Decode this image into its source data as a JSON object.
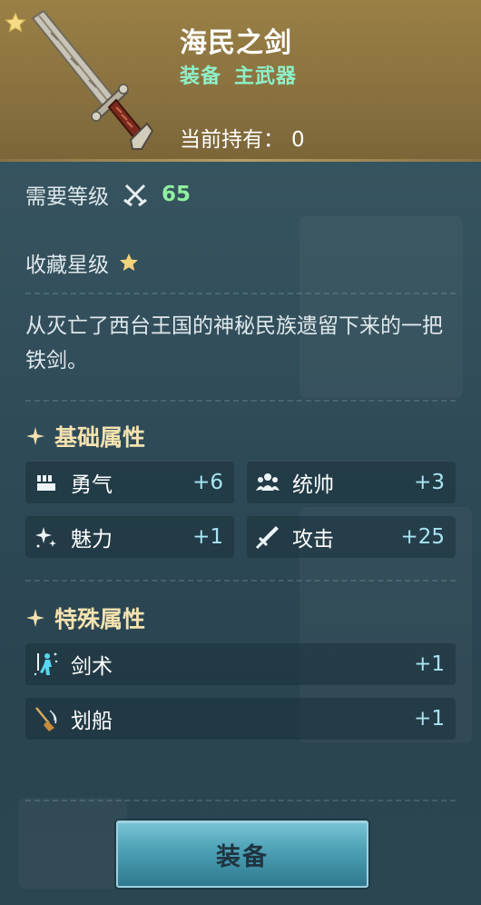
{
  "header": {
    "item_name": "海民之剑",
    "type_category": "装备",
    "type_slot": "主武器",
    "held_label": "当前持有：",
    "held_value": "0",
    "favorite_icon": "star-icon",
    "item_image": "sword"
  },
  "requirements": {
    "level_label": "需要等级",
    "level_icon": "crossed-swords-icon",
    "level_value": "65",
    "collection_label": "收藏星级",
    "collection_stars": 1
  },
  "description": "从灭亡了西台王国的神秘民族遗留下来的一把铁剑。",
  "basic_attributes": {
    "title": "基础属性",
    "items": [
      {
        "name": "勇气",
        "value": "+6",
        "icon": "courage-icon"
      },
      {
        "name": "统帅",
        "value": "+3",
        "icon": "leadership-icon"
      },
      {
        "name": "魅力",
        "value": "+1",
        "icon": "charm-icon"
      },
      {
        "name": "攻击",
        "value": "+25",
        "icon": "attack-sword-icon"
      }
    ]
  },
  "special_attributes": {
    "title": "特殊属性",
    "items": [
      {
        "name": "剑术",
        "value": "+1",
        "icon": "swordsmanship-icon"
      },
      {
        "name": "划船",
        "value": "+1",
        "icon": "rowing-oar-icon"
      }
    ]
  },
  "actions": {
    "equip_label": "装备"
  },
  "colors": {
    "header_gold": "#8a7240",
    "panel_bg": "#2f4a58",
    "type_green": "#8ff0c8",
    "level_green": "#8ff0a0",
    "section_title": "#f4e2b0",
    "stat_value": "#a8e4f2",
    "button": "#4c9fb4"
  }
}
